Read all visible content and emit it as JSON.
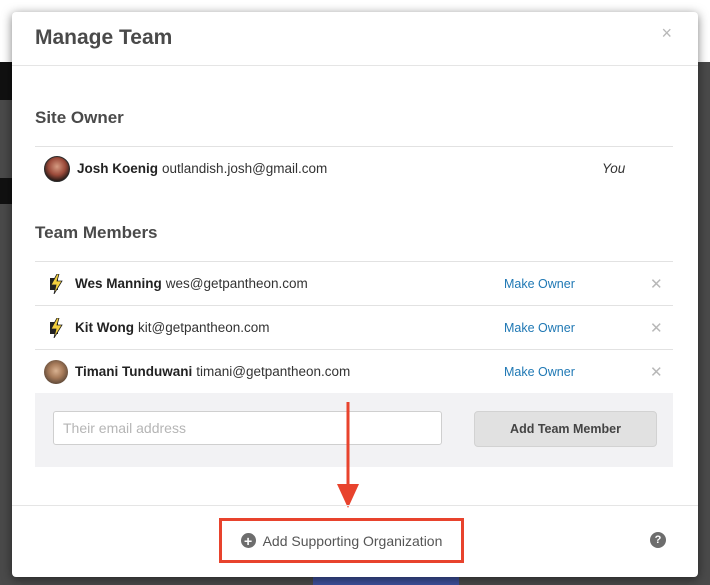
{
  "modal": {
    "title": "Manage Team",
    "close_icon": "close-icon"
  },
  "site_owner": {
    "heading": "Site Owner",
    "owner": {
      "name": "Josh Koenig",
      "email": "outlandish.josh@gmail.com",
      "note": "You"
    }
  },
  "team_members": {
    "heading": "Team Members",
    "members": [
      {
        "name": "Wes Manning",
        "email": "wes@getpantheon.com",
        "avatar": "bolt-icon",
        "action": "Make Owner"
      },
      {
        "name": "Kit Wong",
        "email": "kit@getpantheon.com",
        "avatar": "bolt-icon",
        "action": "Make Owner"
      },
      {
        "name": "Timani Tunduwani",
        "email": "timani@getpantheon.com",
        "avatar": "photo",
        "action": "Make Owner"
      }
    ]
  },
  "add_member": {
    "placeholder": "Their email address",
    "button_label": "Add Team Member"
  },
  "footer": {
    "support_label": "Add Supporting Organization",
    "support_icon": "plus-circle-icon",
    "help_icon": "question-icon"
  },
  "colors": {
    "link": "#1f78b4",
    "highlight": "#e8432d"
  }
}
